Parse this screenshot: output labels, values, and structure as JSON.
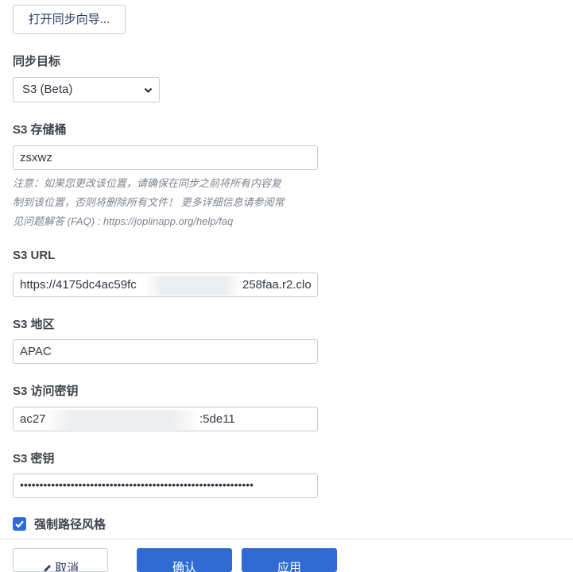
{
  "wizard": {
    "label": "打开同步向导..."
  },
  "sync_target": {
    "label": "同步目标",
    "selected": "S3 (Beta)"
  },
  "s3_bucket": {
    "label": "S3 存储桶",
    "value": "zsxwz",
    "note_line1": "注意：如果您更改该位置，请确保在同步之前将所有内容复",
    "note_line2": "制到该位置，否则将删除所有文件！ 更多详细信息请参阅常",
    "note_line3": "见问题解答 (FAQ) : https://joplinapp.org/help/faq"
  },
  "s3_url": {
    "label": "S3 URL",
    "value_start": "https://4175dc4ac59fc",
    "value_end": "258faa.r2.clo"
  },
  "s3_region": {
    "label": "S3 地区",
    "value": "APAC"
  },
  "s3_access_key": {
    "label": "S3 访问密钥",
    "value_start": "ac27",
    "value_end": ":5de11"
  },
  "s3_secret": {
    "label": "S3 密钥",
    "masked_value": "••••••••••••••••••••••••••••••••••••••••••••••••••••••••••••"
  },
  "force_path_style": {
    "label": "强制路径风格",
    "checked": true
  },
  "footer": {
    "cancel_label": "取消",
    "ok_label": "确认",
    "apply_label": "应用"
  },
  "colors": {
    "accent": "#2f6bd3",
    "border": "#c9ccd1",
    "note_text": "#7f858e"
  }
}
